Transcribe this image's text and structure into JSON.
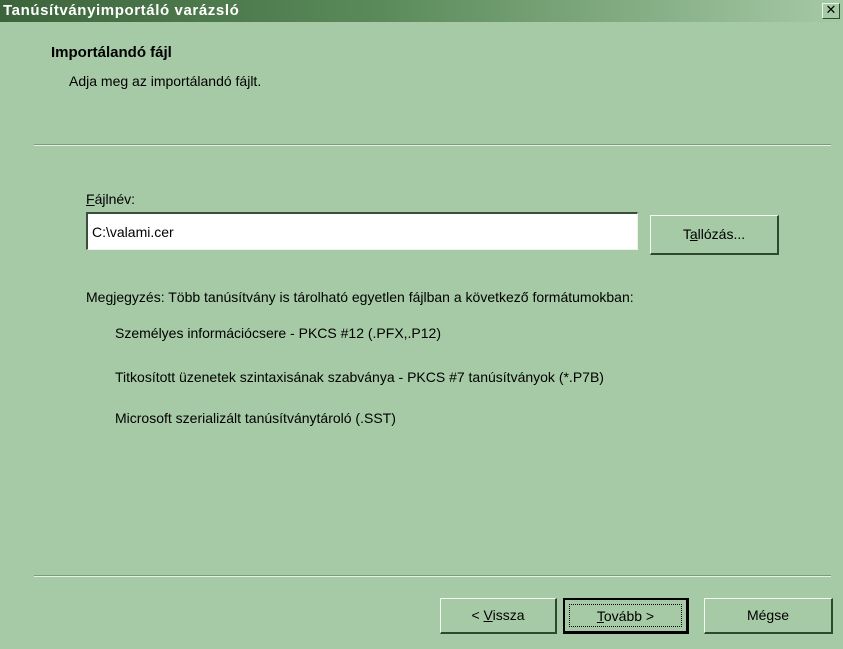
{
  "window": {
    "title": "Tanúsítványimportáló varázsló",
    "close_glyph": "✕"
  },
  "header": {
    "title": "Importálandó fájl",
    "subtitle": "Adja meg az importálandó fájlt."
  },
  "file": {
    "label_mnemonic": "F",
    "label_rest": "ájlnév:",
    "value": "C:\\valami.cer",
    "browse_pre": "T",
    "browse_mnemonic": "a",
    "browse_post": "llózás..."
  },
  "note": {
    "text": "Megjegyzés: Több tanúsítvány is tárolható egyetlen fájlban a következő formátumokban:",
    "formats": [
      "Személyes információcsere - PKCS #12 (.PFX,.P12)",
      "Titkosított üzenetek szintaxisának szabványa - PKCS #7 tanúsítványok (*.P7B)",
      "Microsoft szerializált tanúsítványtároló (.SST)"
    ]
  },
  "buttons": {
    "back_pre": "< ",
    "back_mnemonic": "V",
    "back_post": "issza",
    "next_mnemonic": "T",
    "next_post": "ovább >",
    "cancel": "Mégse"
  },
  "colors": {
    "background": "#a6c9a6",
    "titlebar_start": "#3c643c"
  }
}
